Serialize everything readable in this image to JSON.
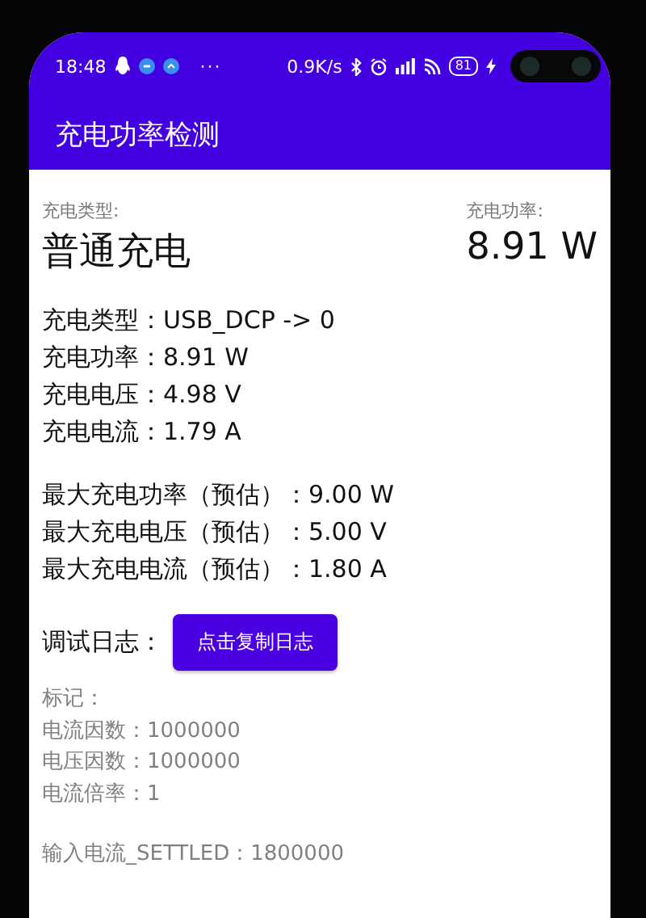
{
  "status_bar": {
    "time": "18:48",
    "dots": "···",
    "speed": "0.9K/s",
    "battery": "81"
  },
  "app_bar": {
    "title": "充电功率检测"
  },
  "summary": [
    {
      "label": "充电类型:",
      "value": "普通充电"
    },
    {
      "label": "充电功率:",
      "value": "8.91 W"
    }
  ],
  "readings": [
    "充电类型：USB_DCP -> 0",
    "充电功率：8.91 W",
    "充电电压：4.98 V",
    "充电电流：1.79 A"
  ],
  "max_estimates": [
    "最大充电功率（预估）：9.00 W",
    "最大充电电压（预估）：5.00 V",
    "最大充电电流（预估）：1.80 A"
  ],
  "debug": {
    "label": "调试日志：",
    "button": "点击复制日志"
  },
  "log_groups": [
    [
      "标记：",
      "电流因数：1000000",
      "电压因数：1000000",
      "电流倍率：1"
    ],
    [
      "输入电流_SETTLED：1800000"
    ]
  ]
}
